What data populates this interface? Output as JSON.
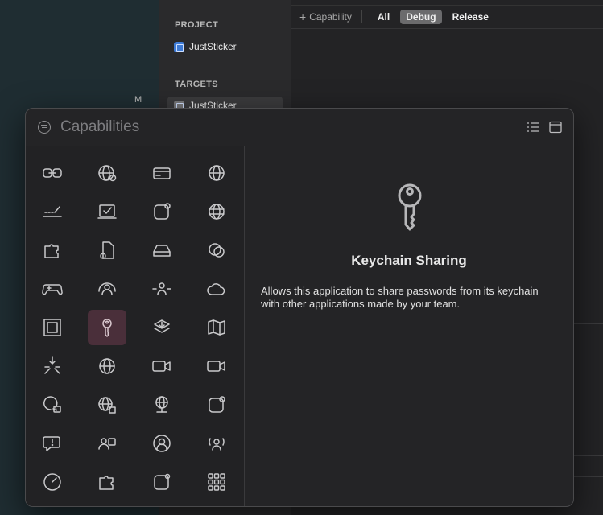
{
  "background": {
    "desktop_letter": "M"
  },
  "navigator": {
    "project_header": "PROJECT",
    "project_name": "JustSticker",
    "targets_header": "TARGETS",
    "target_name": "JustSticker"
  },
  "editor": {
    "add_capability": "Capability",
    "tabs": [
      {
        "label": "All",
        "active": false
      },
      {
        "label": "Debug",
        "active": true
      },
      {
        "label": "Release",
        "active": false
      }
    ]
  },
  "capabilities_panel": {
    "search_placeholder": "Capabilities",
    "icons": [
      "link-icon",
      "globe-badge-icon",
      "card-icon",
      "globe-icon",
      "signature-icon",
      "checkmark-window-icon",
      "app-badge-icon",
      "globe-grid-icon",
      "puzzle-icon",
      "document-gear-icon",
      "drive-icon",
      "overlapping-circles-icon",
      "gamecontroller-icon",
      "person-wave-icon",
      "person-arrows-icon",
      "cloud-icon",
      "frame-icon",
      "key-icon",
      "stack-download-icon",
      "map-icon",
      "arrows-converge-icon",
      "globe-new-icon",
      "video-icon",
      "video-outline-icon",
      "chat-lock-icon",
      "globe-puzzle-icon",
      "globe-network-icon",
      "app-dot-icon",
      "chat-exclamation-icon",
      "people-screen-icon",
      "person-circle-icon",
      "person-waves-icon",
      "gauge-icon",
      "puzzle-outline-icon",
      "app-dot-small-icon",
      "grid-dots-icon"
    ],
    "selected_index": 17,
    "selected": {
      "icon": "key-icon",
      "title": "Keychain Sharing",
      "description": "Allows this application to share passwords from its keychain with other applications made by your team."
    }
  }
}
